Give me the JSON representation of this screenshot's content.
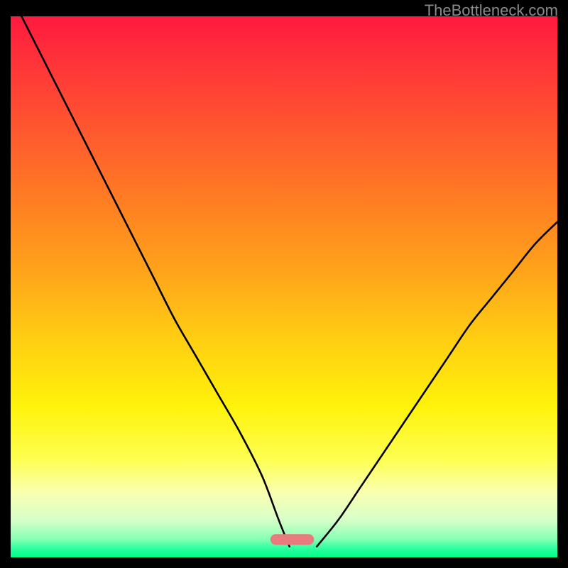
{
  "watermark": "TheBottleneck.com",
  "gradient_stops": [
    {
      "offset": 0.0,
      "color": "#ff1a3e"
    },
    {
      "offset": 0.1,
      "color": "#ff3838"
    },
    {
      "offset": 0.22,
      "color": "#ff5a2e"
    },
    {
      "offset": 0.35,
      "color": "#ff8022"
    },
    {
      "offset": 0.48,
      "color": "#ffa61a"
    },
    {
      "offset": 0.6,
      "color": "#ffcf12"
    },
    {
      "offset": 0.72,
      "color": "#fff20a"
    },
    {
      "offset": 0.82,
      "color": "#fdff52"
    },
    {
      "offset": 0.88,
      "color": "#faffb0"
    },
    {
      "offset": 0.93,
      "color": "#d8ffc8"
    },
    {
      "offset": 0.965,
      "color": "#8affb6"
    },
    {
      "offset": 0.985,
      "color": "#26ff9e"
    },
    {
      "offset": 1.0,
      "color": "#00ff88"
    }
  ],
  "marker": {
    "x_frac": 0.515,
    "y_frac": 0.967,
    "w_frac": 0.08,
    "h_frac": 0.02,
    "color": "#e97a7d"
  },
  "chart_data": {
    "type": "line",
    "title": "",
    "xlabel": "",
    "ylabel": "",
    "xlim": [
      0,
      100
    ],
    "ylim": [
      0,
      100
    ],
    "series": [
      {
        "name": "left-curve",
        "x": [
          2,
          6,
          10,
          14,
          18,
          22,
          26,
          30,
          34,
          38,
          42,
          46,
          49,
          51
        ],
        "y": [
          100,
          92,
          84,
          76,
          68,
          60,
          52,
          44,
          37,
          30,
          23,
          15,
          7,
          2
        ]
      },
      {
        "name": "right-curve",
        "x": [
          56,
          60,
          64,
          68,
          72,
          76,
          80,
          84,
          88,
          92,
          96,
          100
        ],
        "y": [
          2,
          7,
          13,
          19,
          25,
          31,
          37,
          43,
          48,
          53,
          58,
          62
        ]
      }
    ],
    "annotations": [
      {
        "text": "optimal-marker",
        "x": 52,
        "y": 3
      }
    ]
  }
}
